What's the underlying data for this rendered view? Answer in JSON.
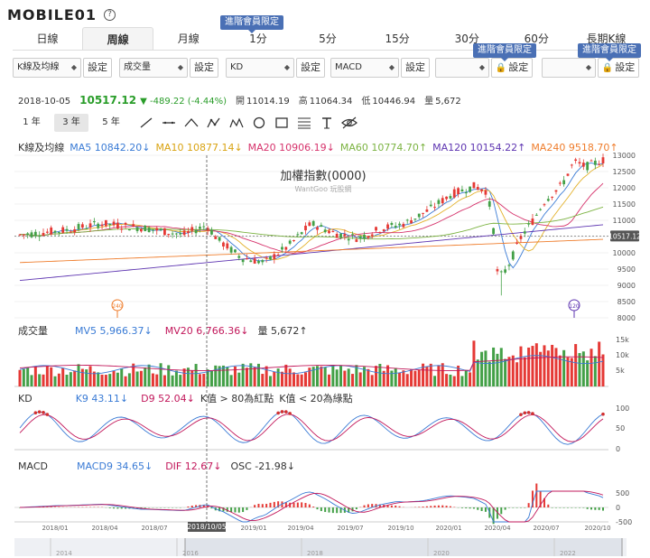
{
  "logo": {
    "text": "MOBILE01"
  },
  "tabs": [
    {
      "label": "日線"
    },
    {
      "label": "周線"
    },
    {
      "label": "月線"
    },
    {
      "label": "1分"
    },
    {
      "label": "5分"
    },
    {
      "label": "15分"
    },
    {
      "label": "30分"
    },
    {
      "label": "60分"
    },
    {
      "label": "長期K線"
    }
  ],
  "vip_label": "進階會員限定",
  "selectors": {
    "s1": "K線及均線",
    "s2": "成交量",
    "s3": "KD",
    "s4": "MACD",
    "s5": "",
    "s6": "",
    "set_label": "設定"
  },
  "quote": {
    "date": "2018-10-05",
    "price": "10517.12",
    "change": "▼ -489.22 (-4.44%)",
    "open_label": "開",
    "open": "11014.19",
    "high_label": "高",
    "high": "11064.34",
    "low_label": "低",
    "low": "10446.94",
    "vol_label": "量",
    "vol": "5,672"
  },
  "ranges": [
    "1 年",
    "3 年",
    "5 年"
  ],
  "colors": {
    "up": "#e53935",
    "down": "#43a047",
    "ma5": "#3a7bd5",
    "ma10": "#e3b12a",
    "ma20": "#d6336c",
    "ma60": "#7cb342",
    "ma120": "#5e35b1",
    "ma240": "#ef7d2c",
    "mv5": "#3a7bd5",
    "mv20": "#c2185b"
  },
  "kline_legend": {
    "name": "K線及均線",
    "items": [
      {
        "label": "MA5",
        "value": "10842.20↓"
      },
      {
        "label": "MA10",
        "value": "10877.14↓"
      },
      {
        "label": "MA20",
        "value": "10906.19↓"
      },
      {
        "label": "MA60",
        "value": "10774.70↑"
      },
      {
        "label": "MA120",
        "value": "10154.22↑"
      },
      {
        "label": "MA240",
        "value": "9518.70↑"
      }
    ]
  },
  "volume_legend": {
    "name": "成交量",
    "mv5_label": "MV5",
    "mv5_value": "5,966.37↓",
    "mv20_label": "MV20",
    "mv20_value": "6,766.36↓",
    "vol_label": "量",
    "vol_value": "5,672↑"
  },
  "kd_legend": {
    "name": "KD",
    "k_label": "K9",
    "k_value": "43.11↓",
    "d_label": "D9",
    "d_value": "52.04↓",
    "note1": "K值 > 80為紅點",
    "note2": "K值 < 20為綠點"
  },
  "macd_legend": {
    "name": "MACD",
    "macd_label": "MACD9",
    "macd_value": "34.65↓",
    "dif_label": "DIF",
    "dif_value": "12.67↓",
    "osc_label": "OSC",
    "osc_value": "-21.98↓"
  },
  "chart_data": {
    "type": "candlestick",
    "title": "加權指數(0000)",
    "watermark": "WantGoo 玩股網",
    "price_axis": [
      "13000",
      "12500",
      "12000",
      "11500",
      "11000",
      "10500",
      "10000",
      "9500",
      "9000",
      "8500",
      "8000"
    ],
    "current_price_label": "10517.12",
    "volume_axis": [
      "15k",
      "10k",
      "5k"
    ],
    "kd_axis": [
      "100",
      "50",
      "0"
    ],
    "macd_axis": [
      "500",
      "0",
      "-500"
    ],
    "x_labels": [
      "2018/01",
      "2018/04",
      "2018/07",
      "2019/01",
      "2019/04",
      "2019/07",
      "2019/10",
      "2020/01",
      "2020/04",
      "2020/07",
      "2020/10"
    ],
    "crosshair_label": "2018/10/05",
    "marker_240": "240",
    "marker_120": "120",
    "navigator_labels": [
      "2014",
      "2016",
      "2018",
      "2020",
      "2022"
    ]
  }
}
